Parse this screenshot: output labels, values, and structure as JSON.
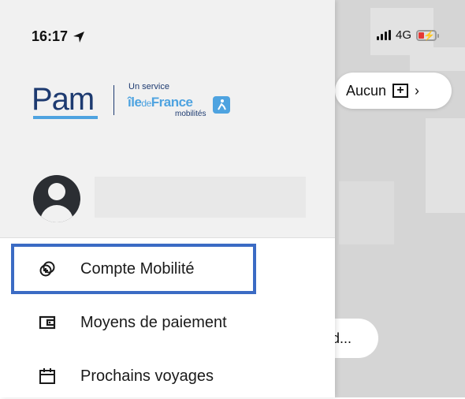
{
  "status_bar": {
    "time": "16:17",
    "network": "4G"
  },
  "logo": {
    "brand": "Pam",
    "tagline": "Un service",
    "partner_ile": "île",
    "partner_de": "de",
    "partner_france": "France",
    "partner_sub": "mobilités"
  },
  "menu": {
    "items": [
      {
        "label": "Compte Mobilité",
        "icon": "account-mobility-icon"
      },
      {
        "label": "Moyens de paiement",
        "icon": "wallet-icon"
      },
      {
        "label": "Prochains voyages",
        "icon": "calendar-icon"
      }
    ]
  },
  "map_overlay": {
    "pill_label": "Aucun",
    "search_partial": "d..."
  },
  "colors": {
    "brand_dark": "#1d3a70",
    "brand_light": "#4ea3e0",
    "highlight": "#3b6bc4"
  }
}
